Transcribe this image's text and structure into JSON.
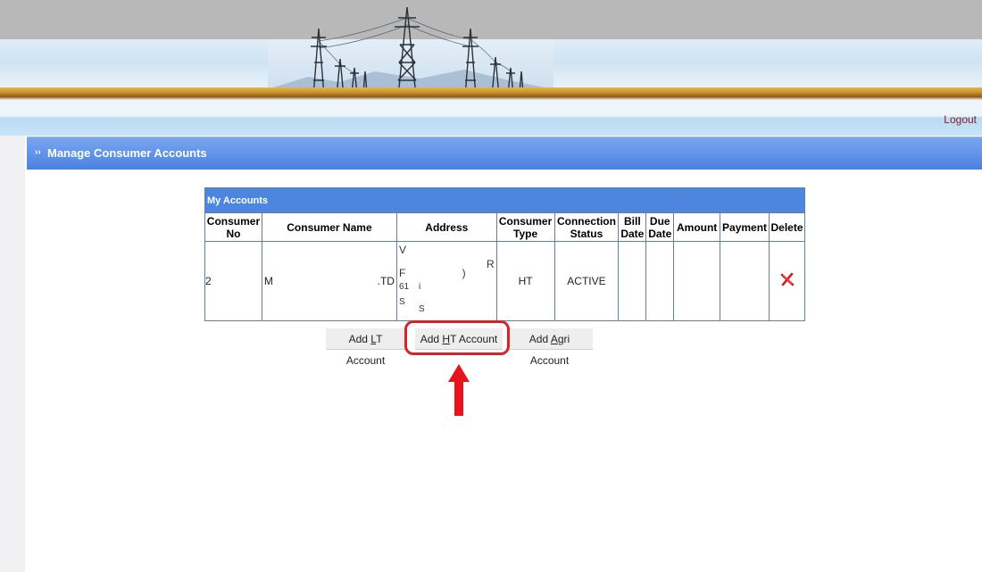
{
  "header": {
    "logout_label": "Logout"
  },
  "section": {
    "title": "Manage Consumer Accounts"
  },
  "accounts_table": {
    "caption": "My Accounts",
    "columns": [
      "Consumer No",
      "Consumer Name",
      "Address",
      "Consumer Type",
      "Connection Status",
      "Bill Date",
      "Due Date",
      "Amount",
      "Payment",
      "Delete"
    ],
    "rows": [
      {
        "consumer_no": "2",
        "consumer_name": "M",
        "consumer_name_suffix": ".TD",
        "address_fragments": [
          "V",
          "R",
          "F",
          ")",
          "61",
          "i",
          "S",
          "S"
        ],
        "consumer_type": "HT",
        "connection_status": "ACTIVE",
        "bill_date": "",
        "due_date": "",
        "amount": "",
        "payment": "",
        "delete_icon": "red-x-icon"
      }
    ]
  },
  "buttons": {
    "add_lt_prefix": "Add ",
    "add_lt_key": "L",
    "add_lt_suffix": "T Account",
    "add_ht_prefix": "Add ",
    "add_ht_key": "H",
    "add_ht_suffix": "T Account",
    "add_agri_prefix": "Add ",
    "add_agri_key": "A",
    "add_agri_suffix": "gri Account"
  },
  "annotation": {
    "highlight_color": "#d8232a",
    "pointer": "red-up-arrow"
  }
}
